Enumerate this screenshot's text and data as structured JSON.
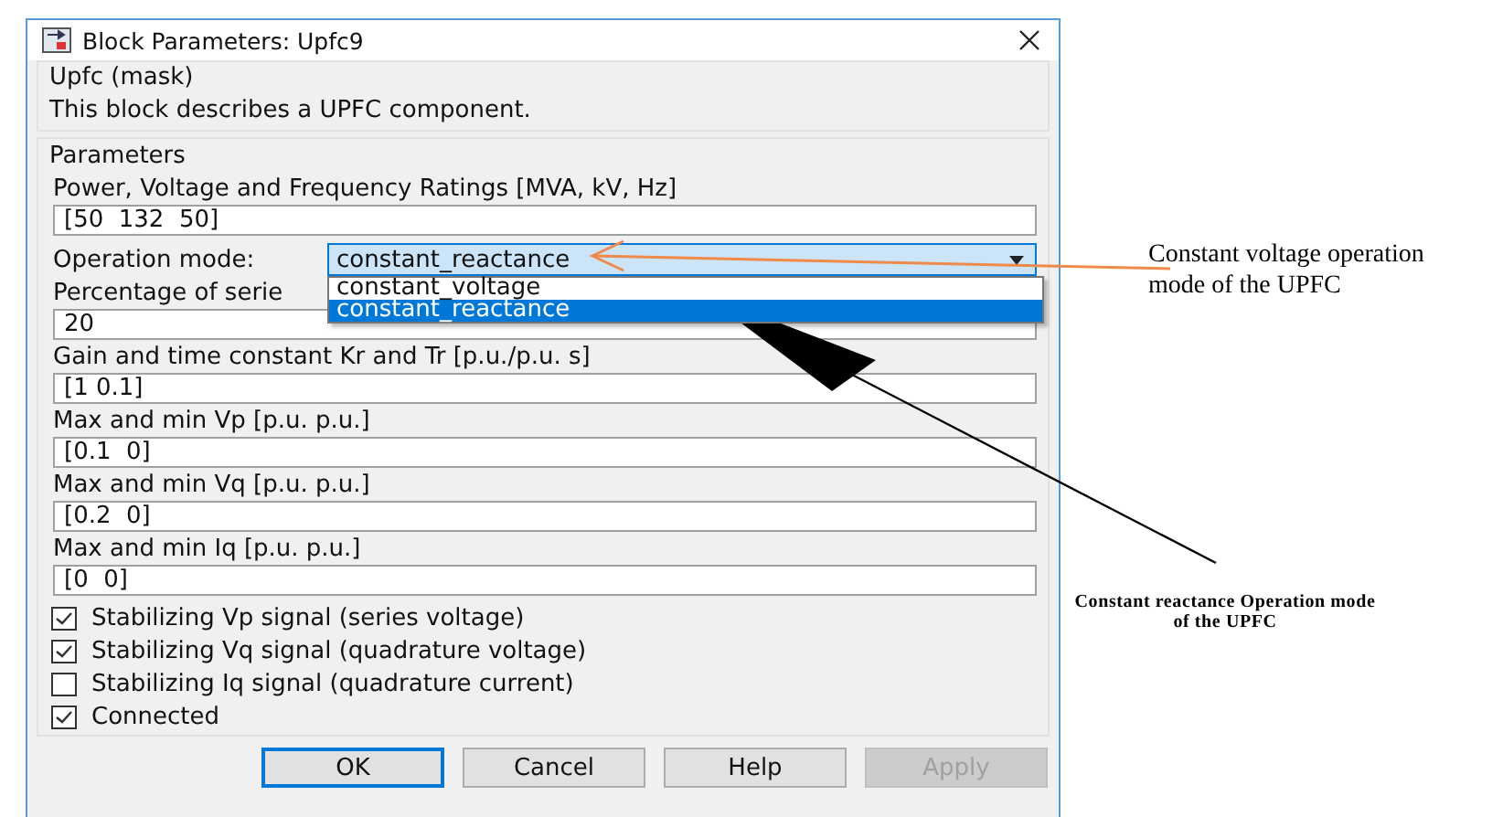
{
  "window": {
    "title": "Block Parameters: Upfc9"
  },
  "mask": {
    "title": "Upfc (mask)",
    "description": "This block describes a UPFC component."
  },
  "parameters": {
    "title": "Parameters",
    "items": [
      {
        "kind": "field",
        "label": "Power, Voltage and Frequency Ratings [MVA, kV, Hz]",
        "value": "[50  132  50]"
      },
      {
        "kind": "dropdown",
        "label": "Operation mode:",
        "value": "constant_reactance",
        "expanded": true,
        "options": [
          {
            "label": "constant_voltage",
            "selected": false
          },
          {
            "label": "constant_reactance",
            "selected": true
          }
        ]
      },
      {
        "kind": "field",
        "label": "Percentage of serie",
        "value": "20"
      },
      {
        "kind": "field",
        "label": "Gain and time constant Kr and Tr [p.u./p.u. s]",
        "value": "[1 0.1]"
      },
      {
        "kind": "field",
        "label": "Max and min Vp [p.u. p.u.]",
        "value": "[0.1  0]"
      },
      {
        "kind": "field",
        "label": "Max and min Vq [p.u. p.u.]",
        "value": "[0.2  0]"
      },
      {
        "kind": "field",
        "label": "Max and min Iq [p.u. p.u.]",
        "value": "[0  0]"
      }
    ],
    "checkboxes": [
      {
        "label": "Stabilizing Vp signal (series voltage)",
        "checked": true
      },
      {
        "label": "Stabilizing Vq signal (quadrature voltage)",
        "checked": true
      },
      {
        "label": "Stabilizing Iq signal (quadrature current)",
        "checked": false
      },
      {
        "label": "Connected",
        "checked": true
      }
    ]
  },
  "buttons": [
    {
      "label": "OK",
      "default": true,
      "disabled": false
    },
    {
      "label": "Cancel",
      "default": false,
      "disabled": false
    },
    {
      "label": "Help",
      "default": false,
      "disabled": false
    },
    {
      "label": "Apply",
      "default": false,
      "disabled": true
    }
  ],
  "annotations": [
    {
      "kind": "orange",
      "text": "Constant voltage operation mode of the UPFC"
    },
    {
      "kind": "black",
      "text": "Constant reactance Operation mode of the UPFC"
    }
  ]
}
